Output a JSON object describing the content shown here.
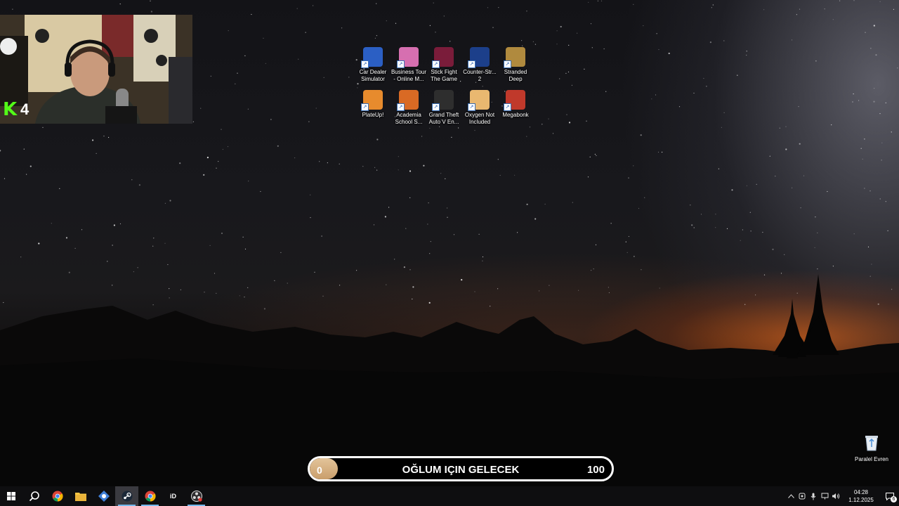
{
  "webcam": {
    "viewer_count": "4",
    "kick_logo_text": "K"
  },
  "desktop_icons": [
    {
      "label": "Car Dealer Simulator",
      "icon": "car-dealer-icon",
      "color": "#2b5fc4"
    },
    {
      "label": "Business Tour - Online M...",
      "icon": "business-tour-icon",
      "color": "#d66fb0"
    },
    {
      "label": "Stick Fight The Game",
      "icon": "stick-fight-icon",
      "color": "#7a1c3a"
    },
    {
      "label": "Counter-Str... 2",
      "icon": "counter-strike-icon",
      "color": "#1c3f8a"
    },
    {
      "label": "Stranded Deep",
      "icon": "stranded-deep-icon",
      "color": "#b08a3e"
    },
    {
      "label": "PlateUp!",
      "icon": "plateup-icon",
      "color": "#e78b2d"
    },
    {
      "label": "Academia School S...",
      "icon": "academia-icon",
      "color": "#d96a24"
    },
    {
      "label": "Grand Theft Auto V En...",
      "icon": "gta-v-icon",
      "color": "#2e2e2e"
    },
    {
      "label": "Oxygen Not Included",
      "icon": "oxygen-not-included-icon",
      "color": "#e9b870"
    },
    {
      "label": "Megabonk",
      "icon": "megabonk-icon",
      "color": "#c0392b"
    }
  ],
  "progress_bar": {
    "start_value": "0",
    "title": "OĞLUM IÇIN GELECEK",
    "end_value": "100",
    "fill_percent": 0
  },
  "recycle_bin": {
    "label": "Paralel Evren"
  },
  "taskbar": {
    "apps": [
      {
        "name": "start-button",
        "icon": "windows-icon"
      },
      {
        "name": "search-button",
        "icon": "search-icon"
      },
      {
        "name": "chrome-button",
        "icon": "chrome-icon"
      },
      {
        "name": "file-explorer-button",
        "icon": "folder-icon"
      },
      {
        "name": "app-button",
        "icon": "gear-app-icon"
      },
      {
        "name": "steam-button",
        "icon": "steam-icon"
      },
      {
        "name": "chrome-profile-button",
        "icon": "chrome-icon"
      },
      {
        "name": "id-app-button",
        "icon": "id-icon"
      },
      {
        "name": "obs-button",
        "icon": "obs-icon"
      }
    ],
    "id_label": "iD",
    "clock_time": "04:28",
    "clock_date": "1.12.2025",
    "notification_count": "6"
  }
}
